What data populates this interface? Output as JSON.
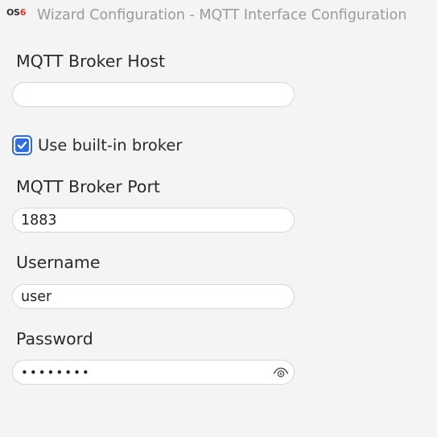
{
  "window": {
    "title": "Wizard Configuration - MQTT Interface Configuration",
    "logo": {
      "prefix": "OS",
      "suffix": "6"
    }
  },
  "form": {
    "broker_host": {
      "label": "MQTT Broker Host",
      "value": "",
      "placeholder": ""
    },
    "builtin_broker": {
      "label": "Use built-in broker",
      "checked": true
    },
    "broker_port": {
      "label": "MQTT Broker Port",
      "value": "1883"
    },
    "username": {
      "label": "Username",
      "value": "user"
    },
    "password": {
      "label": "Password",
      "value": "••••••••",
      "toggle_icon": "eye-icon"
    }
  },
  "colors": {
    "accent": "#2f6fe4",
    "logo_number": "#e0321f",
    "title_text": "#9a9a9a"
  }
}
